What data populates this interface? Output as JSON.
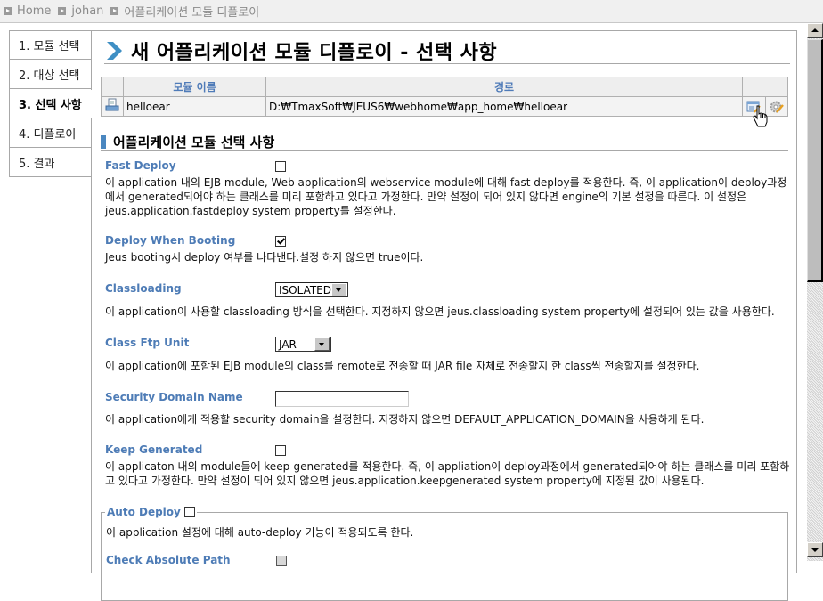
{
  "breadcrumb": {
    "items": [
      "Home",
      "johan",
      "어플리케이션 모듈 디플로이"
    ]
  },
  "left_nav": {
    "items": [
      {
        "label": "1. 모듈 선택",
        "active": false
      },
      {
        "label": "2. 대상 선택",
        "active": false
      },
      {
        "label": "3. 선택 사항",
        "active": true
      },
      {
        "label": "4. 디플로이",
        "active": false
      },
      {
        "label": "5. 결과",
        "active": false
      }
    ]
  },
  "page": {
    "title": "새 어플리케이션 모듈 디플로이 - 선택 사항"
  },
  "module_table": {
    "headers": [
      "",
      "모듈 이름",
      "경로",
      ""
    ],
    "rows": [
      {
        "icon": "ear-module-icon",
        "name": "helloear",
        "path": "D:₩TmaxSoft₩JEUS6₩webhome₩app_home₩helloear",
        "actions": [
          "edit-config-icon",
          "settings-edit-icon"
        ]
      }
    ]
  },
  "section": {
    "title": "어플리케이션 모듈 선택 사항"
  },
  "options": {
    "fast_deploy": {
      "label": "Fast Deploy",
      "checked": false,
      "desc": "이 application 내의 EJB module, Web application의 webservice module에 대해 fast deploy를 적용한다. 즉, 이 application이 deploy과정에서 generated되어야 하는 클래스를 미리 포함하고 있다고 가정한다. 만약 설정이 되어 있지 않다면 engine의 기본 설정을 따른다. 이 설정은 jeus.application.fastdeploy system property를 설정한다."
    },
    "deploy_when_booting": {
      "label": "Deploy When Booting",
      "checked": true,
      "desc": "Jeus booting시 deploy 여부를 나타낸다.설정 하지 않으면 true이다."
    },
    "classloading": {
      "label": "Classloading",
      "value": "ISOLATED",
      "desc": "이 application이 사용할 classloading 방식을 선택한다. 지정하지 않으면 jeus.classloading system property에 설정되어 있는 값을 사용한다."
    },
    "class_ftp_unit": {
      "label": "Class Ftp Unit",
      "value": "JAR",
      "desc": "이 application에 포함된 EJB module의 class를 remote로 전송할 때 JAR file 자체로 전송할지 한 class씩 전송할지를 설정한다."
    },
    "security_domain_name": {
      "label": "Security Domain Name",
      "value": "",
      "desc": "이 application에게 적용할 security domain을 설정한다. 지정하지 않으면 DEFAULT_APPLICATION_DOMAIN을 사용하게 된다."
    },
    "keep_generated": {
      "label": "Keep Generated",
      "checked": false,
      "desc": "이 applicaton 내의 module들에 keep-generated를 적용한다. 즉, 이 appliation이 deploy과정에서 generated되어야 하는 클래스를 미리 포함하고 있다고 가정한다. 만약 설정이 되어 있지 않으면 jeus.application.keepgenerated system property에 지정된 값이 사용된다."
    },
    "auto_deploy": {
      "label": "Auto Deploy",
      "checked": false,
      "desc": "이 application 설정에 대해 auto-deploy 기능이 적용되도록 한다."
    },
    "check_absolute_path": {
      "label": "Check Absolute Path",
      "checked": false,
      "disabled": true
    }
  },
  "colors": {
    "label_blue": "#4e7cb6",
    "accent_blue": "#4a87c0",
    "border_gray": "#a8a8a8"
  }
}
